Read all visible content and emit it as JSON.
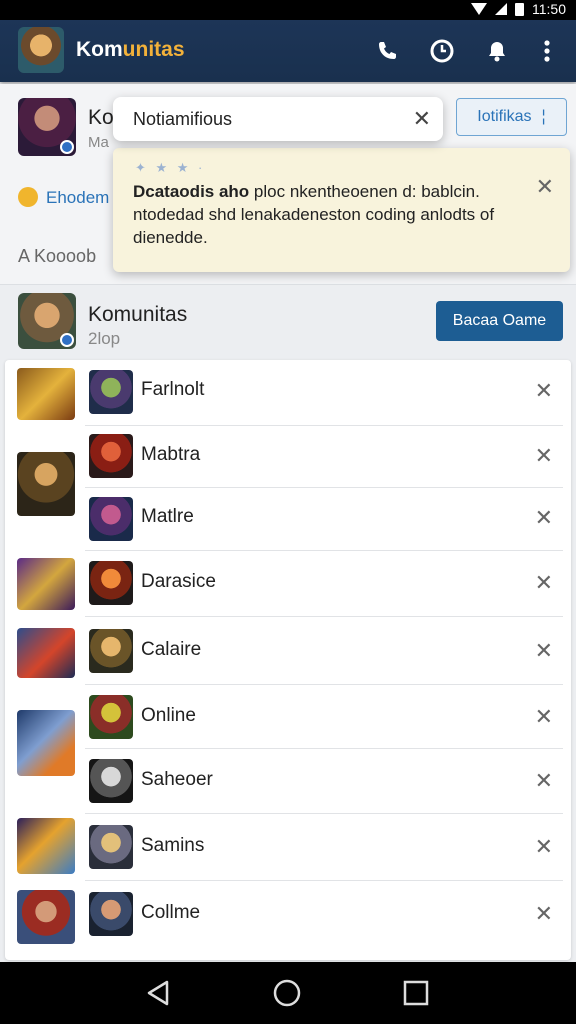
{
  "status": {
    "time": "11:50"
  },
  "app_bar": {
    "title_main": "Kom",
    "title_accent": "unitas"
  },
  "header": {
    "name": "Ko",
    "sub": "Ma",
    "badge": "Ehodem",
    "meta": "A Koooob",
    "notif_button": "Iotifikas",
    "notif_button_icon": "¦"
  },
  "search_popup": {
    "label": "Notiamifious",
    "close": "✕"
  },
  "tooltip": {
    "stars": "✦ ★ ★ ·",
    "bold": "Dcataodis aho",
    "text": " ploc nkentheoenen d: bablcin. ntodedad shd lenakadeneston coding anlodts of dienedde.",
    "close": "✕"
  },
  "group": {
    "title": "Komunitas",
    "sub": "2lop",
    "button": "Bacaa Oame"
  },
  "items": [
    {
      "name": "Farlnolt"
    },
    {
      "name": "Mabtra"
    },
    {
      "name": "Matlre"
    },
    {
      "name": "Darasice"
    },
    {
      "name": "Calaire"
    },
    {
      "name": "Online"
    },
    {
      "name": "Saheoer"
    },
    {
      "name": "Samins"
    },
    {
      "name": "Collme"
    }
  ],
  "close_glyph": "✕",
  "icons": [
    "phone-icon",
    "clock-icon",
    "bell-icon",
    "more-vert-icon",
    "back-icon",
    "home-icon",
    "recents-icon"
  ]
}
